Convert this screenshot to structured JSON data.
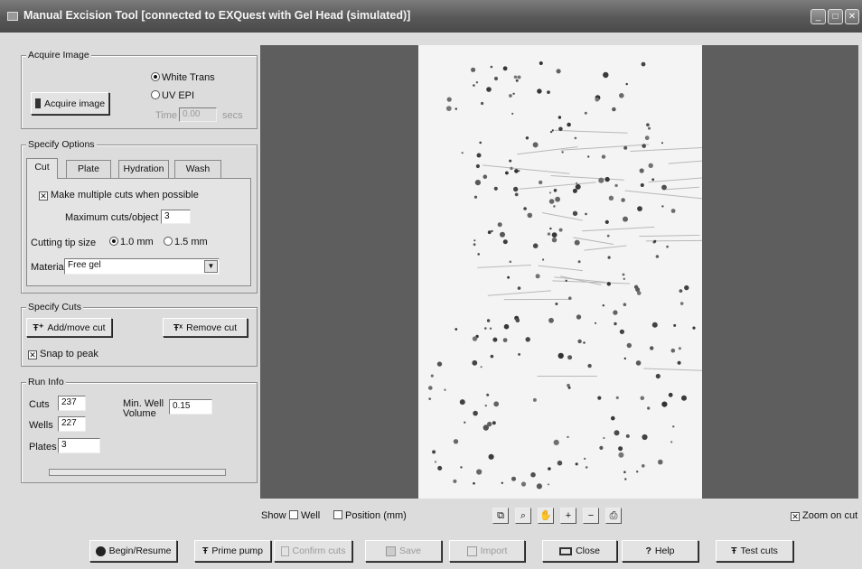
{
  "window": {
    "title": "Manual Excision Tool [connected to EXQuest with Gel Head (simulated)]",
    "icon": "monitor-icon"
  },
  "acquire": {
    "group_title": "Acquire Image",
    "button": "Acquire image",
    "radio_white": "White Trans",
    "radio_uv": "UV EPI",
    "time_label": "Time",
    "time_value": "0.00",
    "time_unit": "secs"
  },
  "options": {
    "group_title": "Specify Options",
    "tabs": [
      "Cut",
      "Plate",
      "Hydration",
      "Wash"
    ],
    "multi_cut": "Make multiple cuts when possible",
    "max_label": "Maximum cuts/object",
    "max_value": "3",
    "tip_label": "Cutting tip size",
    "tip_1": "1.0 mm",
    "tip_2": "1.5 mm",
    "material_label": "Material",
    "material_value": "Free gel"
  },
  "cuts": {
    "group_title": "Specify Cuts",
    "add": "Add/move cut",
    "remove": "Remove cut",
    "snap": "Snap to peak"
  },
  "run": {
    "group_title": "Run Info",
    "cuts_label": "Cuts",
    "cuts_value": "237",
    "wells_label": "Wells",
    "wells_value": "227",
    "plates_label": "Plates",
    "plates_value": "3",
    "minwell_label_1": "Min. Well",
    "minwell_label_2": "Volume",
    "minwell_value": "0.15"
  },
  "show": {
    "label": "Show",
    "well": "Well",
    "position": "Position (mm)",
    "zoom_on_cut": "Zoom on cut"
  },
  "toolbar": {
    "begin": "Begin/Resume",
    "prime": "Prime pump",
    "confirm": "Confirm cuts",
    "save": "Save",
    "import": "Import",
    "close": "Close",
    "help": "Help",
    "test": "Test cuts"
  }
}
